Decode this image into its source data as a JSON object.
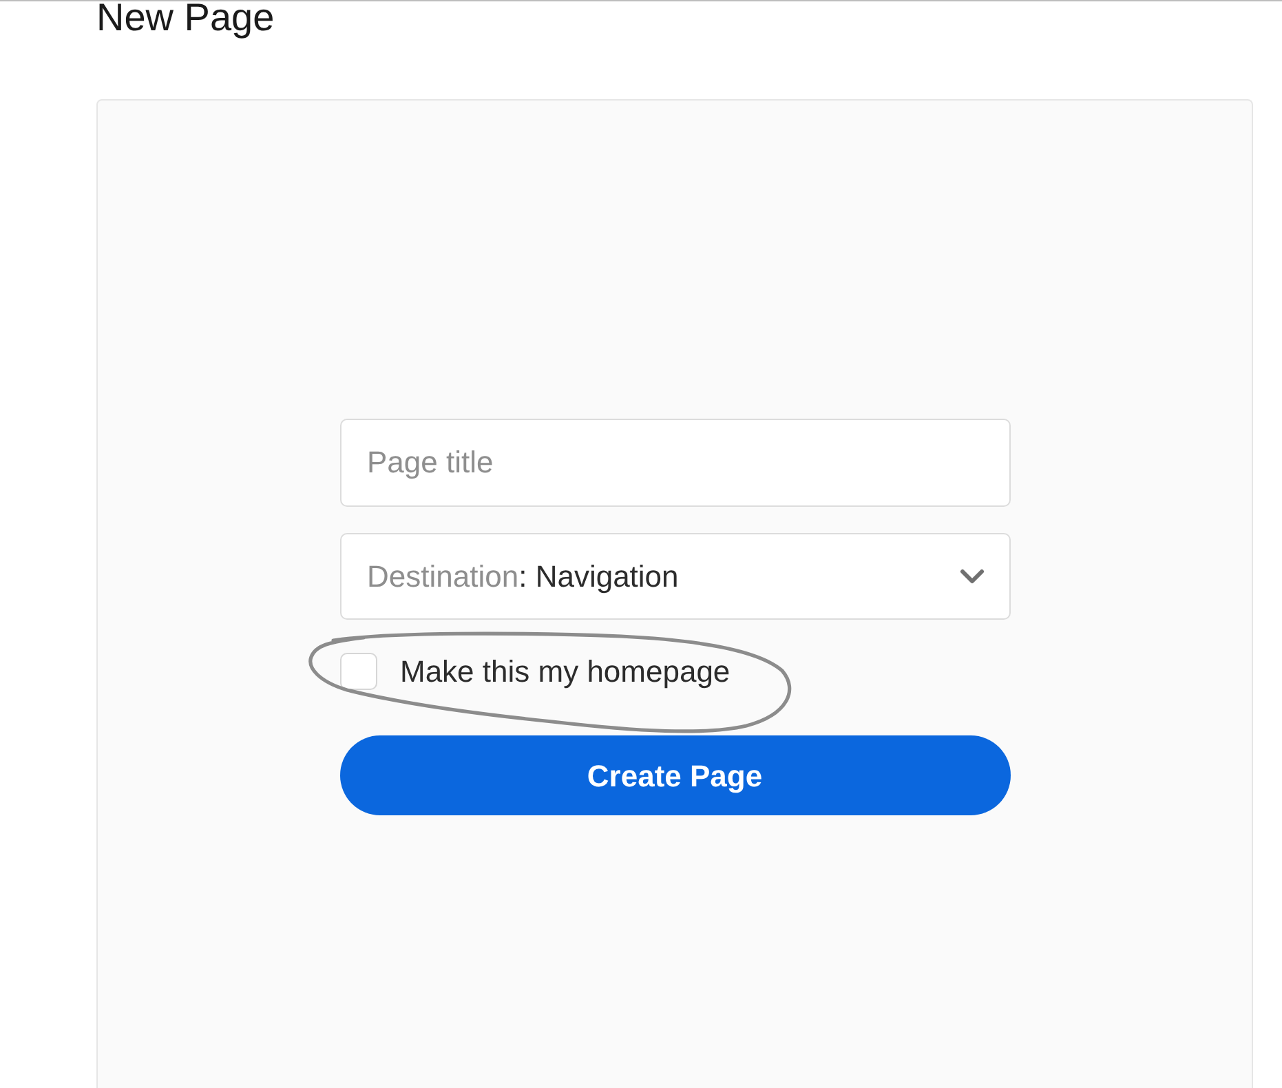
{
  "header": {
    "title": "New Page"
  },
  "form": {
    "title_field": {
      "placeholder": "Page title"
    },
    "destination": {
      "label": "Destination",
      "separator": ":",
      "value": "Navigation"
    },
    "homepage": {
      "label": "Make this my homepage",
      "checked": false
    },
    "submit": {
      "label": "Create Page"
    }
  },
  "annotation": {
    "kind": "hand-drawn-loop"
  }
}
